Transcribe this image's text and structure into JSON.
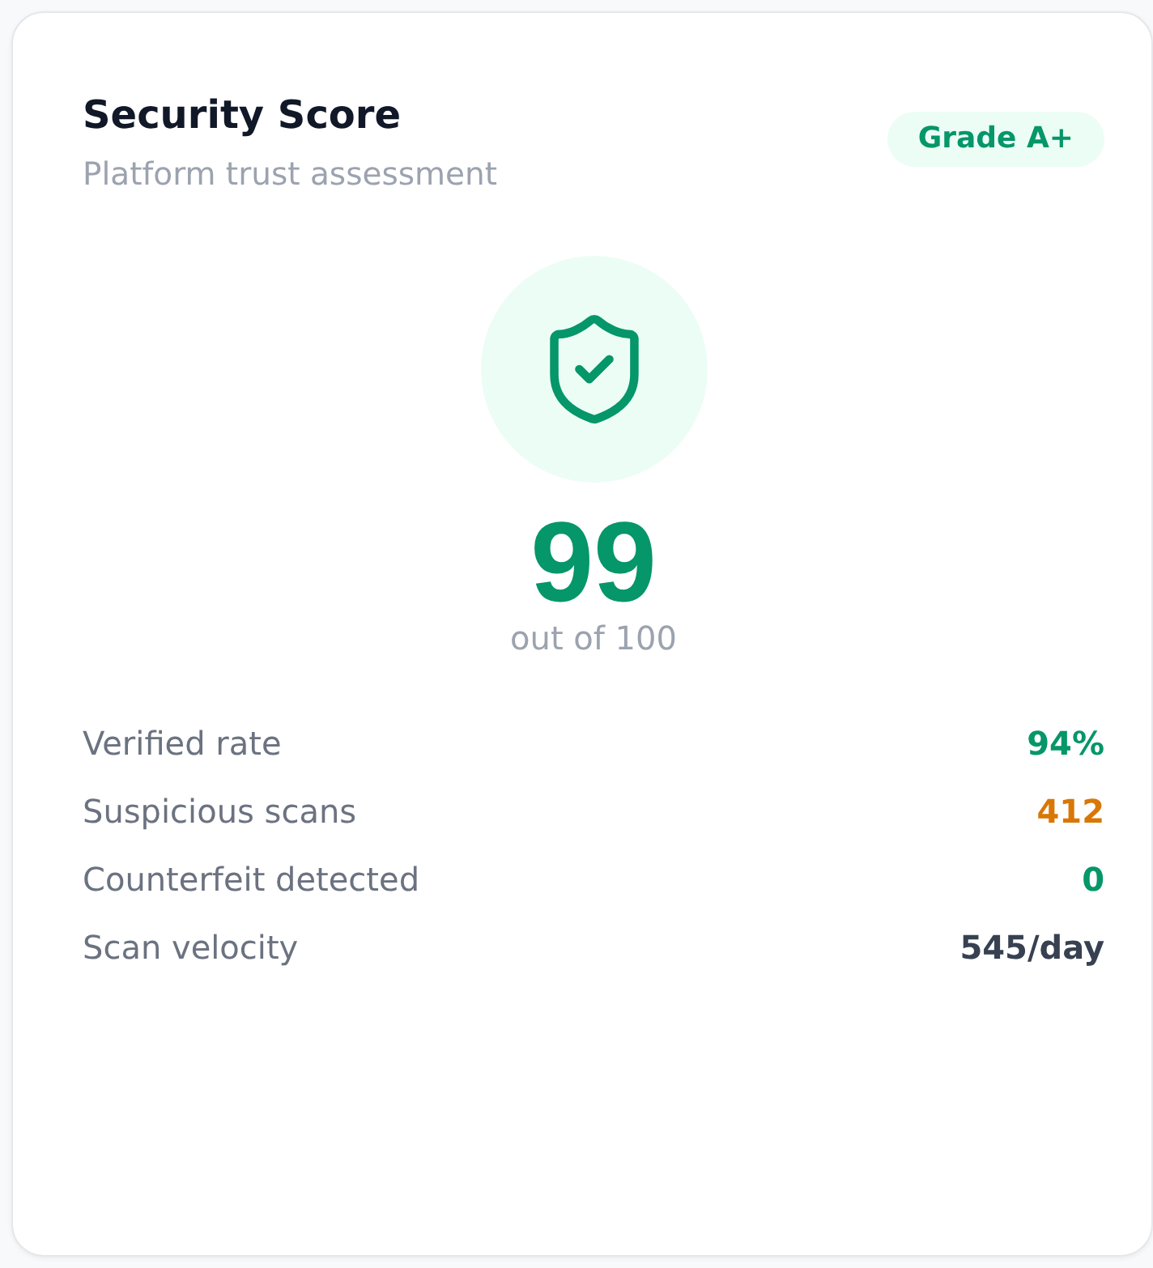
{
  "card": {
    "title": "Security Score",
    "subtitle": "Platform trust assessment",
    "badge": "Grade A+"
  },
  "score": {
    "value": "99",
    "caption": "out of 100"
  },
  "metrics": [
    {
      "label": "Verified rate",
      "value": "94%",
      "color": "#059669"
    },
    {
      "label": "Suspicious scans",
      "value": "412",
      "color": "#d97706"
    },
    {
      "label": "Counterfeit detected",
      "value": "0",
      "color": "#059669"
    },
    {
      "label": "Scan velocity",
      "value": "545/day",
      "color": "#374151"
    }
  ]
}
